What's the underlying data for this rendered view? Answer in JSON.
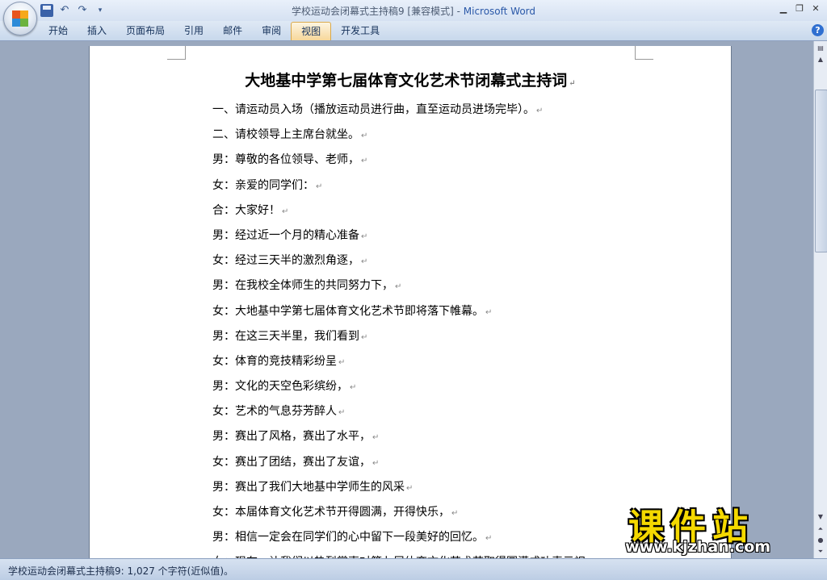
{
  "window": {
    "title_doc": "学校运动会闭幕式主持稿9 [兼容模式]",
    "title_sep": " - ",
    "title_app": "Microsoft Word"
  },
  "quick_access": {
    "icons": [
      "save-icon",
      "undo-icon",
      "redo-icon",
      "customize-icon"
    ]
  },
  "ribbon": {
    "tabs": [
      "开始",
      "插入",
      "页面布局",
      "引用",
      "邮件",
      "审阅",
      "视图",
      "开发工具"
    ],
    "active_tab": "视图"
  },
  "document": {
    "title": "大地基中学第七届体育文化艺术节闭幕式主持词",
    "paragraph_mark": "↵",
    "lines": [
      "一、请运动员入场（播放运动员进行曲，直至运动员进场完毕）。",
      "二、请校领导上主席台就坐。",
      "男：尊敬的各位领导、老师，",
      "女：亲爱的同学们：",
      "合：大家好！",
      "男：经过近一个月的精心准备",
      "女：经过三天半的激烈角逐，",
      "男：在我校全体师生的共同努力下，",
      "女：大地基中学第七届体育文化艺术节即将落下帷幕。",
      "男：在这三天半里，我们看到",
      "女：体育的竞技精彩纷呈",
      "男：文化的天空色彩缤纷，",
      "女：艺术的气息芬芳醉人",
      "男：赛出了风格，赛出了水平，",
      "女：赛出了团结，赛出了友谊，",
      "男：赛出了我们大地基中学师生的风采",
      "女：本届体育文化艺术节开得圆满，开得快乐，",
      "男：相信一定会在同学们的心中留下一段美好的回忆。",
      "女：现在，让我们以热烈掌声对第七届体育文化艺术节取得圆满成功表示祝"
    ]
  },
  "statusbar": {
    "text": "学校运动会闭幕式主持稿9: 1,027 个字符(近似值)。"
  },
  "watermark": {
    "chinese": "课件站",
    "url": "www.kjzhan.com"
  }
}
